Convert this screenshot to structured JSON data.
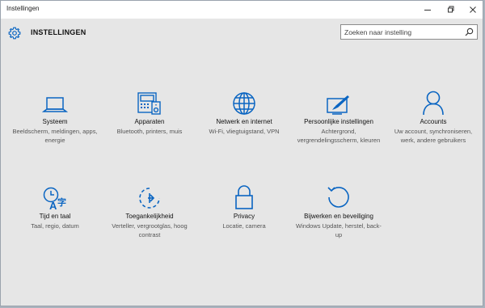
{
  "window": {
    "title": "Instellingen"
  },
  "header": {
    "app_title": "INSTELLINGEN",
    "search_placeholder": "Zoeken naar instelling"
  },
  "tiles": [
    {
      "id": "systeem",
      "icon": "laptop-icon",
      "label": "Systeem",
      "desc": "Beeldscherm, meldingen, apps, energie"
    },
    {
      "id": "apparaten",
      "icon": "devices-icon",
      "label": "Apparaten",
      "desc": "Bluetooth, printers, muis"
    },
    {
      "id": "netwerk",
      "icon": "globe-icon",
      "label": "Netwerk en internet",
      "desc": "Wi-Fi, vliegtuigstand, VPN"
    },
    {
      "id": "persoonlijk",
      "icon": "personalization-icon",
      "label": "Persoonlijke instellingen",
      "desc": "Achtergrond, vergrendelingsscherm, kleuren"
    },
    {
      "id": "accounts",
      "icon": "person-icon",
      "label": "Accounts",
      "desc": "Uw account, synchroniseren, werk, andere gebruikers"
    },
    {
      "id": "tijd",
      "icon": "time-language-icon",
      "label": "Tijd en taal",
      "desc": "Taal, regio, datum"
    },
    {
      "id": "toegankelijk",
      "icon": "ease-of-access-icon",
      "label": "Toegankelijkheid",
      "desc": "Verteller, vergrootglas, hoog contrast"
    },
    {
      "id": "privacy",
      "icon": "lock-icon",
      "label": "Privacy",
      "desc": "Locatie, camera"
    },
    {
      "id": "update",
      "icon": "update-icon",
      "label": "Bijwerken en beveiliging",
      "desc": "Windows Update, herstel, back-up"
    }
  ],
  "colors": {
    "accent": "#0a65c2",
    "background": "#e6e6e6"
  }
}
